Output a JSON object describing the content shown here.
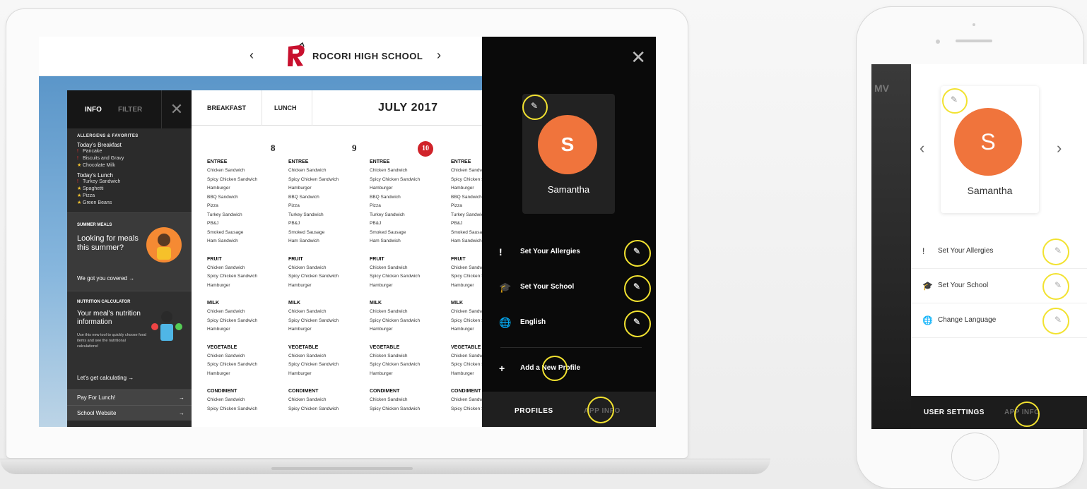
{
  "laptop": {
    "header": {
      "prev_glyph": "‹",
      "next_glyph": "›",
      "school_name": "ROCORI HIGH SCHOOL"
    },
    "sidebar": {
      "tab_info": "INFO",
      "tab_filter": "FILTER",
      "close_glyph": "✕",
      "allergens_label": "ALLERGENS & FAVORITES",
      "breakfast_group": "Today's Breakfast",
      "breakfast_items": [
        {
          "mark": "!",
          "text": "Pancake"
        },
        {
          "mark": "!",
          "text": "Biscuits and Gravy"
        },
        {
          "mark": "★",
          "text": "Chocolate Milk"
        }
      ],
      "lunch_group": "Today's Lunch",
      "lunch_items": [
        {
          "mark": "!",
          "text": "Turkey Sandwich"
        },
        {
          "mark": "★",
          "text": "Spaghetti"
        },
        {
          "mark": "★",
          "text": "Pizza"
        },
        {
          "mark": "★",
          "text": "Green Beans"
        }
      ],
      "summer_label": "SUMMER MEALS",
      "summer_text": "Looking for meals this summer?",
      "summer_cta": "We got you covered →",
      "nutrition_label": "NUTRITION CALCULATOR",
      "nutrition_text": "Your meal's nutrition information",
      "nutrition_small": "Use this new tool to quickly choose food items and see the nutritional calculations!",
      "nutrition_cta": "Let's get calculating →",
      "links": [
        "Pay For Lunch!",
        "School Website"
      ],
      "link_arrow": "→"
    },
    "menu": {
      "tab_breakfast": "BREAKFAST",
      "tab_lunch": "LUNCH",
      "month": "JULY 2017",
      "days": [
        {
          "num": "8",
          "today": false
        },
        {
          "num": "9",
          "today": false
        },
        {
          "num": "10",
          "today": true
        },
        {
          "num": "",
          "today": false
        }
      ],
      "categories": [
        {
          "name": "ENTREE",
          "items": [
            "Chicken Sandwich",
            "Spicy Chicken Sandwich",
            "Hamburger",
            "BBQ Sandwich",
            "Pizza",
            "Turkey Sandwich",
            "PB&J",
            "Smoked Sausage",
            "Ham Sandwich"
          ]
        },
        {
          "name": "FRUIT",
          "items": [
            "Chicken Sandwich",
            "Spicy Chicken Sandwich",
            "Hamburger"
          ]
        },
        {
          "name": "MILK",
          "items": [
            "Chicken Sandwich",
            "Spicy Chicken Sandwich",
            "Hamburger"
          ]
        },
        {
          "name": "VEGETABLE",
          "items": [
            "Chicken Sandwich",
            "Spicy Chicken Sandwich",
            "Hamburger"
          ]
        },
        {
          "name": "CONDIMENT",
          "items": [
            "Chicken Sandwich",
            "Spicy Chicken Sandwich"
          ]
        }
      ]
    },
    "overlay": {
      "close_glyph": "✕",
      "avatar_letter": "S",
      "name": "Samantha",
      "rows": [
        {
          "icon": "!",
          "label": "Set Your Allergies"
        },
        {
          "icon": "🎓",
          "label": "Set Your School"
        },
        {
          "icon": "🌐",
          "label": "English"
        }
      ],
      "add_icon": "+",
      "add_label": "Add a New Profile",
      "tab_profiles": "PROFILES",
      "tab_app_info": "APP INFO",
      "edit_glyph": "✎"
    }
  },
  "phone": {
    "bg_label": "MV",
    "avatar_letter": "S",
    "name": "Samantha",
    "prev_glyph": "‹",
    "next_glyph": "›",
    "rows": [
      {
        "icon": "!",
        "label": "Set Your Allergies"
      },
      {
        "icon": "🎓",
        "label": "Set Your School"
      },
      {
        "icon": "🌐",
        "label": "Change Language"
      }
    ],
    "edit_glyph": "✎",
    "tab_user_settings": "USER SETTINGS",
    "tab_app_info": "APP INFO"
  },
  "colors": {
    "accent_orange": "#f0743c",
    "highlight_yellow": "#f2e230",
    "today_red": "#d0232a"
  }
}
